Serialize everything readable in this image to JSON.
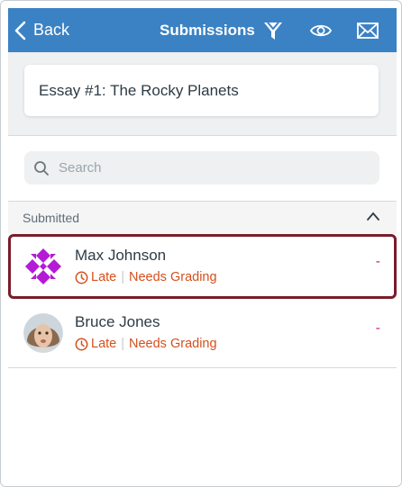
{
  "navbar": {
    "back_label": "Back",
    "title": "Submissions",
    "icons": [
      "filter-icon",
      "eye-icon",
      "mail-icon"
    ],
    "background": "#3b82c4"
  },
  "assignment": {
    "title": "Essay #1: The Rocky Planets"
  },
  "search": {
    "placeholder": "Search"
  },
  "section": {
    "label": "Submitted"
  },
  "submissions": [
    {
      "name": "Max Johnson",
      "status_late": "Late",
      "status_grading": "Needs Grading",
      "grade": "-",
      "highlighted": true
    },
    {
      "name": "Bruce Jones",
      "status_late": "Late",
      "status_grading": "Needs Grading",
      "grade": "-",
      "highlighted": false
    }
  ],
  "colors": {
    "status": "#d4501c",
    "grade": "#d91b8c",
    "highlight_border": "#7a1c2b",
    "avatar_pattern": "#b41bd6"
  }
}
